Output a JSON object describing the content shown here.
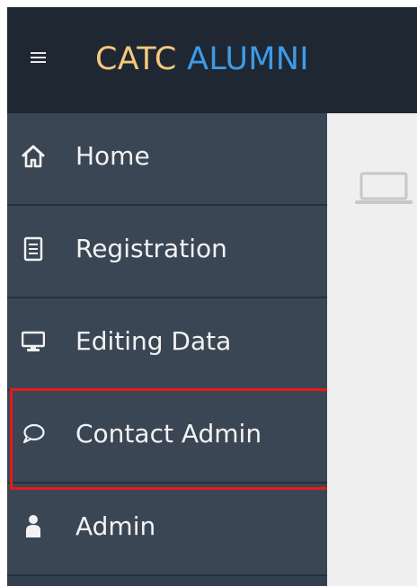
{
  "header": {
    "brand_part1": "CATC",
    "brand_part2": "ALUMNI",
    "menu_icon": "hamburger-menu-icon"
  },
  "sidebar": {
    "items": [
      {
        "label": "Home",
        "icon": "home-icon"
      },
      {
        "label": "Registration",
        "icon": "document-icon"
      },
      {
        "label": "Editing Data",
        "icon": "monitor-icon"
      },
      {
        "label": "Contact Admin",
        "icon": "chat-bubble-icon",
        "highlighted": true
      },
      {
        "label": "Admin",
        "icon": "user-icon"
      }
    ]
  },
  "main": {
    "icon": "laptop-icon"
  },
  "colors": {
    "topbar_bg": "#1f2733",
    "sidebar_bg": "#3b4655",
    "brand_part1": "#f4c97c",
    "brand_part2": "#3d9be6",
    "highlight_border": "#e81919"
  }
}
